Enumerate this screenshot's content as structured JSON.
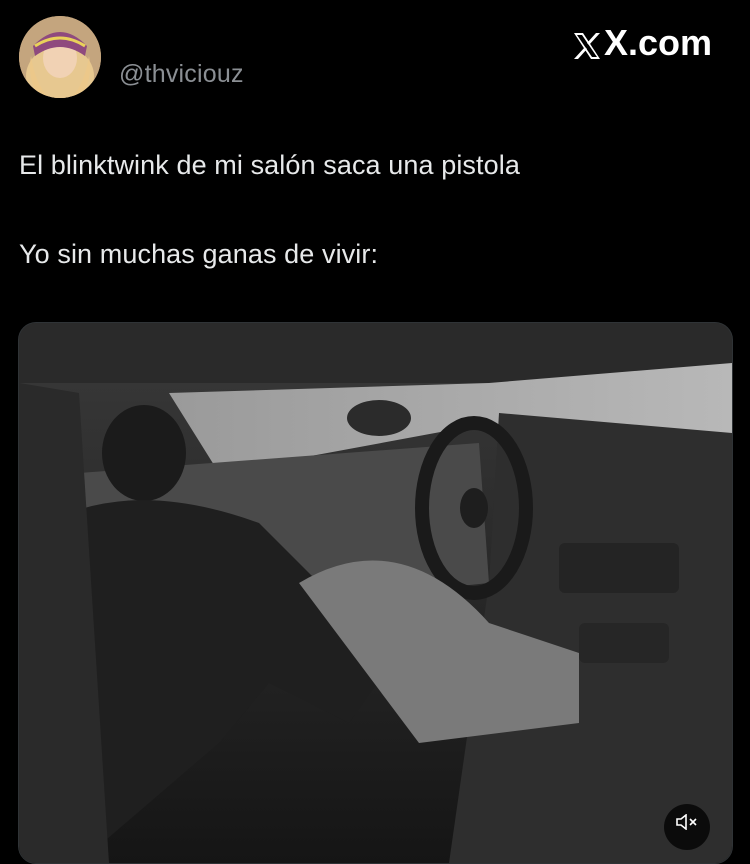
{
  "brand": {
    "label": "X.com",
    "icon": "x-logo-icon"
  },
  "author": {
    "handle": "@thviciouz",
    "avatar_icon": "avatar"
  },
  "tweet": {
    "line1": "El blinktwink de mi salón saca una pistola",
    "line2": "Yo sin muchas ganas de vivir:"
  },
  "media": {
    "type": "video",
    "mute_icon": "speaker-muted-icon"
  },
  "colors": {
    "background": "#000000",
    "text": "#e7e9ea",
    "secondary_text": "#8b8f94",
    "border": "#2f3336"
  }
}
